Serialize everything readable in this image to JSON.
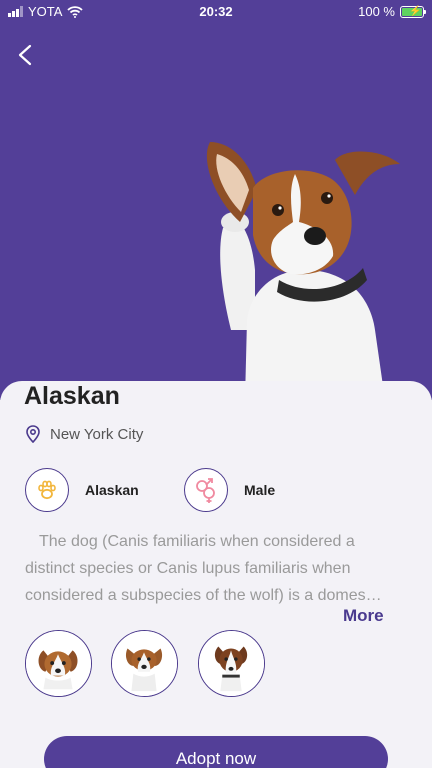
{
  "status_bar": {
    "carrier": "YOTA",
    "time": "20:32",
    "battery_percent": "100 %",
    "battery_level": 1.0
  },
  "theme": {
    "primary": "#533f98",
    "accent_text": "#4a3a8f",
    "background": "#f3f2f7",
    "breed_icon_color": "#f2b63c",
    "gender_icon_color": "#f08aa0"
  },
  "pet": {
    "name": "Alaskan",
    "location": "New York City",
    "breed": "Alaskan",
    "gender": "Male",
    "description": "The dog (Canis familiaris when considered a distinct species or Canis lupus familiaris when considered a subspecies of the wolf) is a domes…",
    "more_label": "More"
  },
  "icons": {
    "back": "chevron-left-icon",
    "location": "location-pin-icon",
    "breed": "paw-icon",
    "gender": "gender-icon"
  },
  "gallery": {
    "photo_count": 3
  },
  "actions": {
    "adopt_label": "Adopt now"
  }
}
